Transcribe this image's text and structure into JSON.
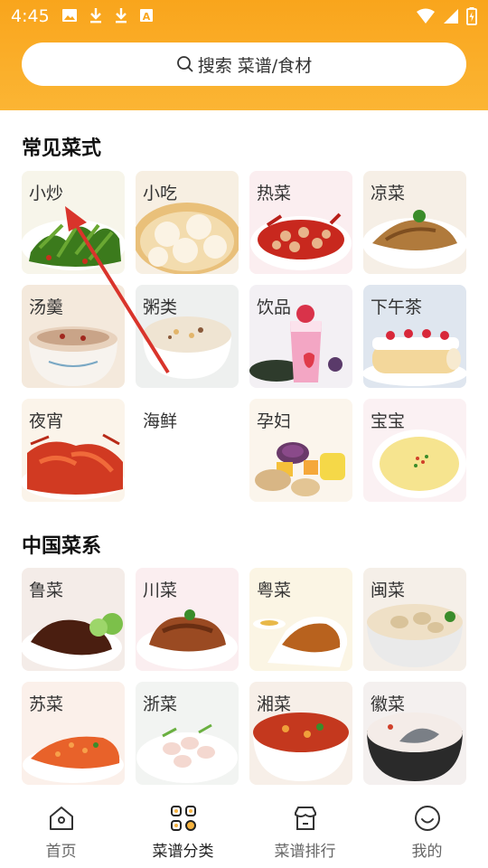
{
  "status_bar": {
    "time": "4:45",
    "left_icons": [
      "image-icon",
      "download-icon",
      "download-icon",
      "text-a-icon"
    ],
    "right_icons": [
      "wifi-icon",
      "signal-icon",
      "battery-icon"
    ]
  },
  "search": {
    "placeholder": "搜索 菜谱/食材",
    "icon": "search-icon"
  },
  "sections": [
    {
      "title": "常见菜式",
      "items": [
        {
          "label": "小炒"
        },
        {
          "label": "小吃"
        },
        {
          "label": "热菜"
        },
        {
          "label": "凉菜"
        },
        {
          "label": "汤羹"
        },
        {
          "label": "粥类"
        },
        {
          "label": "饮品"
        },
        {
          "label": "下午茶"
        },
        {
          "label": "夜宵"
        },
        {
          "label": "海鲜"
        },
        {
          "label": "孕妇"
        },
        {
          "label": "宝宝"
        }
      ]
    },
    {
      "title": "中国菜系",
      "items": [
        {
          "label": "鲁菜"
        },
        {
          "label": "川菜"
        },
        {
          "label": "粤菜"
        },
        {
          "label": "闽菜"
        },
        {
          "label": "苏菜"
        },
        {
          "label": "浙菜"
        },
        {
          "label": "湘菜"
        },
        {
          "label": "徽菜"
        }
      ]
    }
  ],
  "tabbar": [
    {
      "label": "首页",
      "icon": "home-icon",
      "active": false
    },
    {
      "label": "菜谱分类",
      "icon": "category-icon",
      "active": true
    },
    {
      "label": "菜谱排行",
      "icon": "store-icon",
      "active": false
    },
    {
      "label": "我的",
      "icon": "smile-icon",
      "active": false
    }
  ],
  "colors": {
    "header": "#f9a51c",
    "accent": "#f6b33f",
    "active_icon": "#e8a020"
  }
}
